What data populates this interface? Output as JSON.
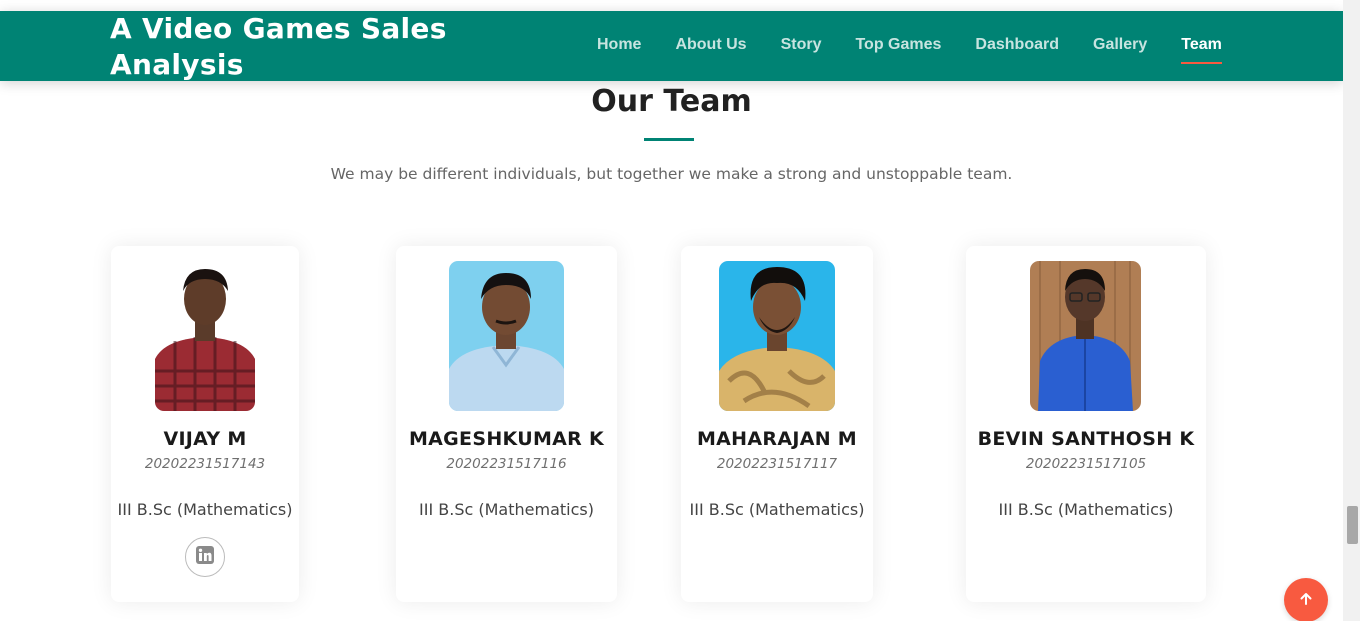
{
  "header": {
    "title_line1": "A Video Games Sales",
    "title_line2": "Analysis",
    "nav": [
      {
        "label": "Home",
        "active": false
      },
      {
        "label": "About Us",
        "active": false
      },
      {
        "label": "Story",
        "active": false
      },
      {
        "label": "Top Games",
        "active": false
      },
      {
        "label": "Dashboard",
        "active": false
      },
      {
        "label": "Gallery",
        "active": false
      },
      {
        "label": "Team",
        "active": true
      }
    ]
  },
  "team": {
    "title": "Our Team",
    "subtitle": "We may be different individuals, but together we make a strong and unstoppable team.",
    "members": [
      {
        "name": "VIJAY M",
        "id": "20202231517143",
        "course": "III B.Sc (Mathematics)",
        "has_linkedin": true,
        "shirt_color": "#9b2b33",
        "photo_bg": "#ffffff"
      },
      {
        "name": "MAGESHKUMAR K",
        "id": "20202231517116",
        "course": "III B.Sc (Mathematics)",
        "has_linkedin": false,
        "shirt_color": "#bcd9f0",
        "photo_bg": "#7ed0ef"
      },
      {
        "name": "MAHARAJAN M",
        "id": "20202231517117",
        "course": "III B.Sc (Mathematics)",
        "has_linkedin": false,
        "shirt_color": "#d9b46a",
        "photo_bg": "#2ab5ea"
      },
      {
        "name": "BEVIN SANTHOSH K",
        "id": "20202231517105",
        "course": "III B.Sc (Mathematics)",
        "has_linkedin": false,
        "shirt_color": "#2a5fd1",
        "photo_bg": "#b07e54"
      }
    ]
  },
  "colors": {
    "brand": "#008374",
    "accent": "#f85a40"
  },
  "icons": {
    "linkedin": "linkedin-icon",
    "back_to_top": "arrow-up-icon"
  }
}
